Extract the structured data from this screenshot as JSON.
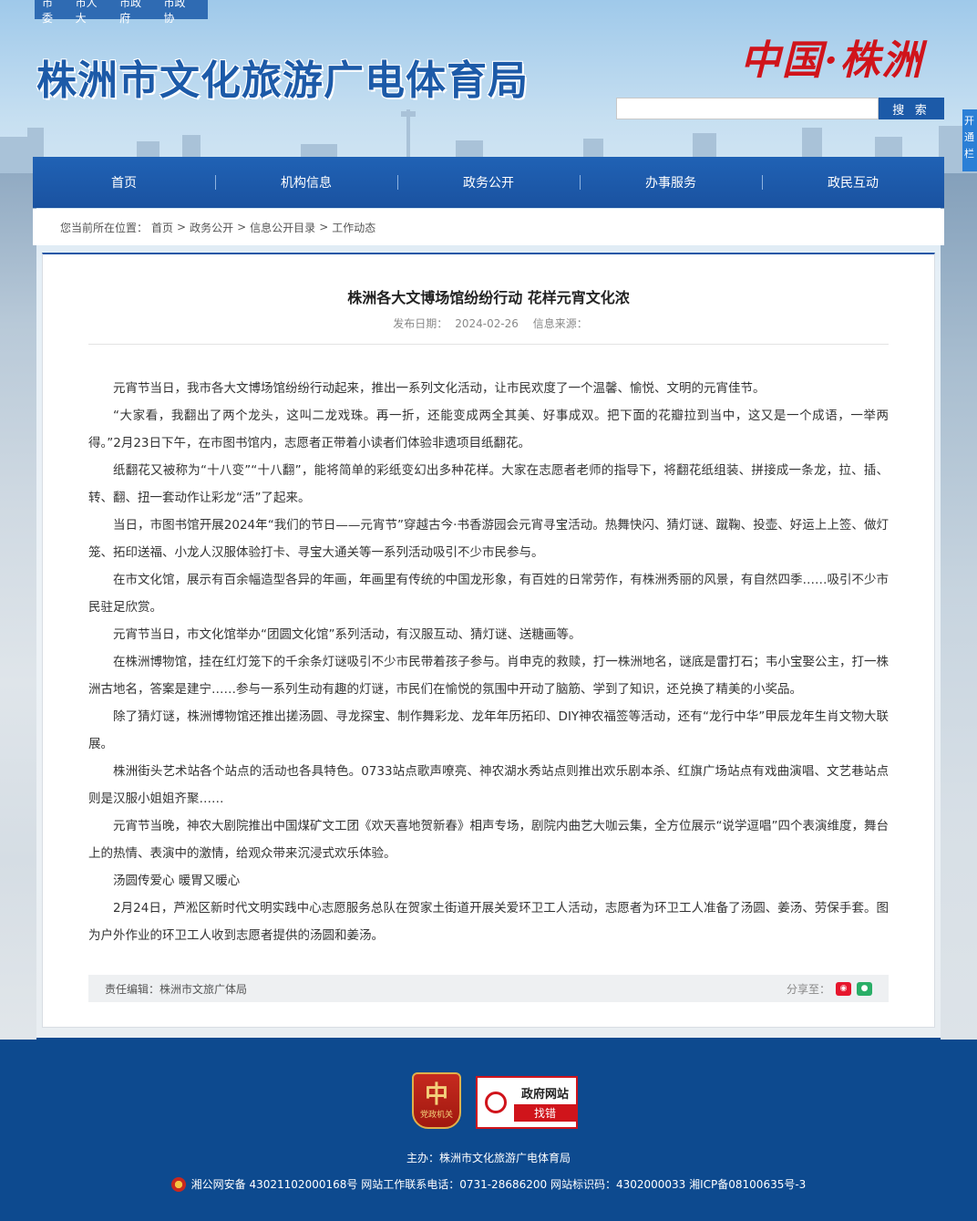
{
  "topbar": {
    "links": [
      "市委",
      "市人大",
      "市政府",
      "市政协"
    ]
  },
  "header": {
    "title": "株洲市文化旅游广电体育局",
    "logo_text": "中国·株洲",
    "search_placeholder": "",
    "search_button": "搜 索",
    "side_tab": "开通栏"
  },
  "nav": {
    "items": [
      "首页",
      "机构信息",
      "政务公开",
      "办事服务",
      "政民互动"
    ]
  },
  "breadcrumb": {
    "label": "您当前所在位置：",
    "items": [
      "首页",
      "政务公开",
      "信息公开目录",
      "工作动态"
    ],
    "sep": ">"
  },
  "article": {
    "title": "株洲各大文博场馆纷纷行动 花样元宵文化浓",
    "date_label": "发布日期：",
    "date": "2024-02-26",
    "source_label": "信息来源：",
    "paragraphs": [
      "元宵节当日，我市各大文博场馆纷纷行动起来，推出一系列文化活动，让市民欢度了一个温馨、愉悦、文明的元宵佳节。",
      "“大家看，我翻出了两个龙头，这叫二龙戏珠。再一折，还能变成两全其美、好事成双。把下面的花瓣拉到当中，这又是一个成语，一举两得。”2月23日下午，在市图书馆内，志愿者正带着小读者们体验非遗项目纸翻花。",
      "纸翻花又被称为“十八变”“十八翻”，能将简单的彩纸变幻出多种花样。大家在志愿者老师的指导下，将翻花纸组装、拼接成一条龙，拉、插、转、翻、扭一套动作让彩龙“活”了起来。",
      "当日，市图书馆开展2024年“我们的节日——元宵节”穿越古今·书香游园会元宵寻宝活动。热舞快闪、猜灯谜、蹴鞠、投壶、好运上上签、做灯笼、拓印送福、小龙人汉服体验打卡、寻宝大通关等一系列活动吸引不少市民参与。",
      "在市文化馆，展示有百余幅造型各异的年画，年画里有传统的中国龙形象，有百姓的日常劳作，有株洲秀丽的风景，有自然四季……吸引不少市民驻足欣赏。",
      "元宵节当日，市文化馆举办“团圆文化馆”系列活动，有汉服互动、猜灯谜、送糖画等。",
      "在株洲博物馆，挂在红灯笼下的千余条灯谜吸引不少市民带着孩子参与。肖申克的救赎，打一株洲地名，谜底是雷打石；韦小宝娶公主，打一株洲古地名，答案是建宁……参与一系列生动有趣的灯谜，市民们在愉悦的氛围中开动了脑筋、学到了知识，还兑换了精美的小奖品。",
      "除了猜灯谜，株洲博物馆还推出搓汤圆、寻龙探宝、制作舞彩龙、龙年年历拓印、DIY神农福签等活动，还有“龙行中华”甲辰龙年生肖文物大联展。",
      "株洲街头艺术站各个站点的活动也各具特色。0733站点歌声嘹亮、神农湖水秀站点则推出欢乐剧本杀、红旗广场站点有戏曲演唱、文艺巷站点则是汉服小姐姐齐聚……",
      "元宵节当晚，神农大剧院推出中国煤矿文工团《欢天喜地贺新春》相声专场，剧院内曲艺大咖云集，全方位展示“说学逗唱”四个表演维度，舞台上的热情、表演中的激情，给观众带来沉浸式欢乐体验。",
      "汤圆传爱心 暖胃又暖心",
      "2月24日，芦淞区新时代文明实践中心志愿服务总队在贺家土街道开展关爱环卫工人活动，志愿者为环卫工人准备了汤圆、姜汤、劳保手套。图为户外作业的环卫工人收到志愿者提供的汤圆和姜汤。"
    ],
    "editor": "责任编辑：株洲市文旅广体局",
    "share_label": "分享至："
  },
  "footer": {
    "party_badge": "党政机关",
    "party_char": "中",
    "gov_badge_line1": "政府网站",
    "gov_badge_line2": "找错",
    "sponsor": "主办：株洲市文化旅游广电体育局",
    "icp": "湘公网安备 43021102000168号 网站工作联系电话：0731-28686200 网站标识码：4302000033 湘ICP备08100635号-3"
  },
  "colors": {
    "brand_blue": "#1c57a6",
    "footer_blue": "#0d4a8f",
    "accent_red": "#d0141b"
  }
}
